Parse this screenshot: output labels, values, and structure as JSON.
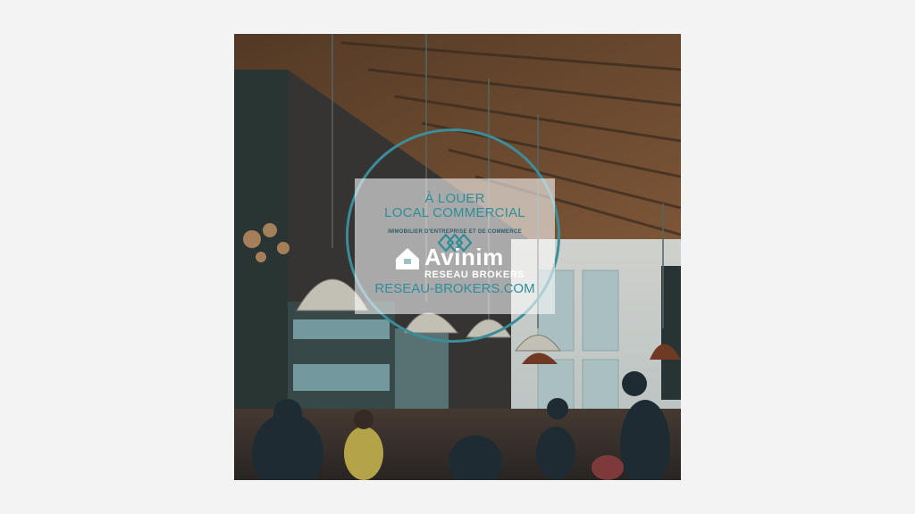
{
  "ad": {
    "line1": "À LOUER",
    "line2": "LOCAL COMMERCIAL",
    "tagline": "IMMOBILIER D'ENTREPRISE ET DE COMMERCE",
    "brand": "Avinim",
    "brand_sub": "RESEAU BROKERS",
    "website": "RESEAU-BROKERS.COM",
    "accent_color": "#2f8d9a"
  },
  "icons": [
    "diamond-logo-icon",
    "house-arrow-icon"
  ]
}
